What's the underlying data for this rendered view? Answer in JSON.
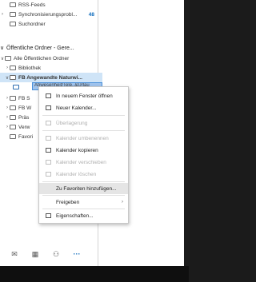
{
  "folders": {
    "rss": "RSS-Feeds",
    "sync": "Synchronisierungsprobl...",
    "sync_count": "48",
    "search": "Suchordner"
  },
  "section": {
    "chevron": "∨",
    "title": "Öffentliche Ordner - Gere..."
  },
  "tree": {
    "all_public": "Alle Öffentlichen Ordner",
    "bibliothek": "Bibliothek",
    "fb_angewandte": "FB Angewandte Naturwi...",
    "selected_item": "Abwesenheit/Tele..&Urlau",
    "fb_s": "FB S",
    "fb_w": "FB W",
    "praes": "Präs",
    "verw": "Verw",
    "favoriten": "Favori"
  },
  "context_menu": {
    "items": [
      {
        "label": "In neuem Fenster öffnen",
        "enabled": true
      },
      {
        "label": "Neuer Kalender...",
        "enabled": true
      },
      {
        "label": "Überlagerung",
        "enabled": false
      },
      {
        "label": "Kalender umbenennen",
        "enabled": false
      },
      {
        "label": "Kalender kopieren",
        "enabled": true
      },
      {
        "label": "Kalender verschieben",
        "enabled": false
      },
      {
        "label": "Kalender löschen",
        "enabled": false
      },
      {
        "label": "Zu Favoriten hinzufügen...",
        "enabled": true
      },
      {
        "label": "Freigeben",
        "enabled": true
      },
      {
        "label": "Eigenschaften...",
        "enabled": true
      }
    ]
  },
  "bottom_nav": [
    "mail-icon",
    "calendar-icon",
    "people-icon",
    "more-icon"
  ],
  "colors": {
    "accent": "#0f6cbd",
    "selection": "#cfe4f7",
    "highlight": "#9fc3ec"
  }
}
